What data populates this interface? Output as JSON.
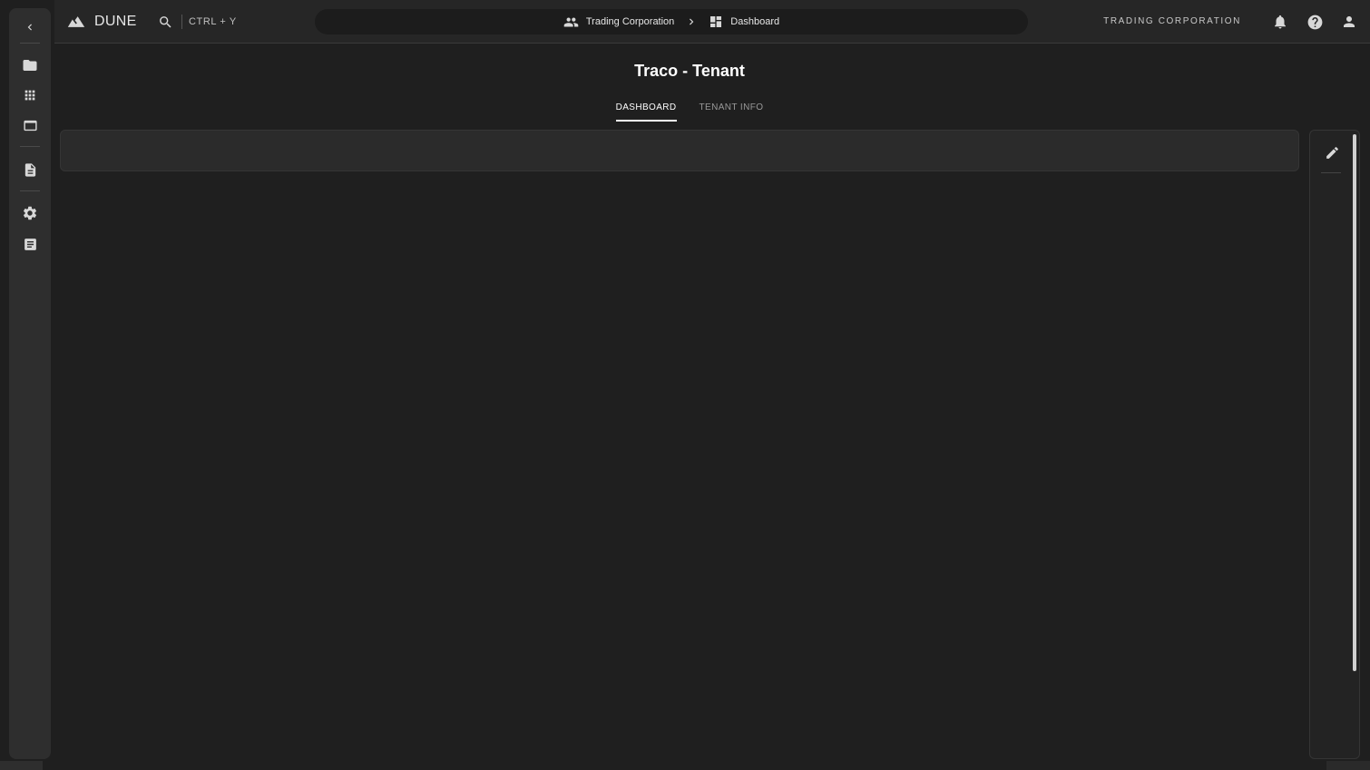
{
  "app": {
    "name": "DUNE"
  },
  "search": {
    "shortcut": "CTRL + Y"
  },
  "breadcrumb": [
    {
      "label": "Trading Corporation",
      "icon": "people-icon"
    },
    {
      "label": "Dashboard",
      "icon": "dashboard-icon"
    }
  ],
  "header": {
    "tenant_label": "TRADING CORPORATION"
  },
  "page": {
    "title": "Traco - Tenant",
    "tabs": [
      {
        "label": "DASHBOARD",
        "active": true
      },
      {
        "label": "TENANT INFO",
        "active": false
      }
    ]
  },
  "sidebar": {
    "icons": [
      "chevron-left-icon",
      "folder-icon",
      "apps-grid-icon",
      "window-icon",
      "document-icon",
      "gear-icon",
      "article-icon"
    ]
  },
  "colors": {
    "background": "#1f1f1f",
    "rail": "#2e2e2e",
    "text": "#e6e6e6"
  }
}
